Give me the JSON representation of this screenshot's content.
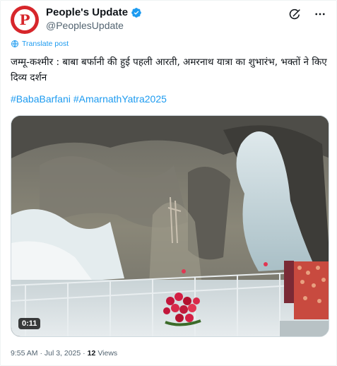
{
  "post": {
    "author": {
      "display_name": "People's Update",
      "handle": "@PeoplesUpdate",
      "verified": true,
      "avatar_letter": "P"
    },
    "translate_label": "Translate post",
    "text": "जम्मू-कश्मीर : बाबा बर्फानी की हुई पहली आरती, अमरनाथ यात्रा का शुभारंभ, भक्तों ने किए दिव्य दर्शन",
    "hashtags": [
      "#BabaBarfani",
      "#AmarnathYatra2025"
    ],
    "media": {
      "type": "video",
      "duration": "0:11"
    },
    "timestamp": "9:55 AM · Jul 3, 2025 ·",
    "views_count": "12",
    "views_label": "Views"
  },
  "icons": {
    "header": [
      "grok-icon",
      "more-icon"
    ],
    "translate": "globe-icon",
    "verified": "verified-badge-icon"
  },
  "colors": {
    "accent": "#1d9bf0",
    "text_primary": "#0f1419",
    "text_secondary": "#536471",
    "avatar_bg": "#d7262b"
  }
}
